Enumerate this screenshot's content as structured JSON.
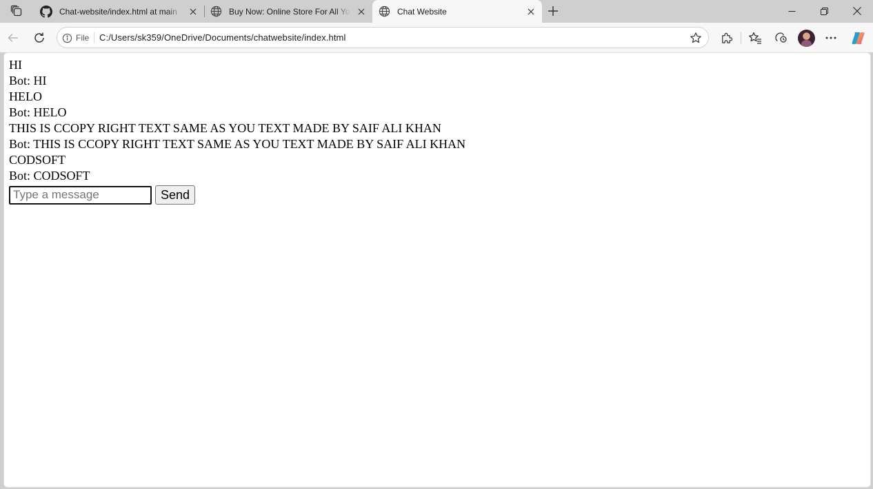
{
  "browser": {
    "tabs": [
      {
        "title": "Chat-website/index.html at main",
        "favicon": "github-icon",
        "active": false
      },
      {
        "title": "Buy Now: Online Store For All You",
        "favicon": "globe-icon",
        "active": false
      },
      {
        "title": "Chat Website",
        "favicon": "globe-icon",
        "active": true
      }
    ],
    "address": {
      "site_label": "File",
      "url": "C:/Users/sk359/OneDrive/Documents/chatwebsite/index.html"
    },
    "toolbar_icons": [
      "back-icon",
      "refresh-icon",
      "info-icon",
      "star-icon",
      "extensions-icon",
      "favorites-icon",
      "browser-essentials-icon",
      "profile-avatar",
      "more-icon",
      "copilot-icon"
    ]
  },
  "chat": {
    "messages": [
      {
        "text": "HI"
      },
      {
        "text": "Bot: HI"
      },
      {
        "text": "HELO"
      },
      {
        "text": "Bot: HELO"
      },
      {
        "text": "THIS IS CCOPY RIGHT TEXT SAME AS YOU TEXT MADE BY SAIF ALI KHAN"
      },
      {
        "text": "Bot: THIS IS CCOPY RIGHT TEXT SAME AS YOU TEXT MADE BY SAIF ALI KHAN"
      },
      {
        "text": "CODSOFT"
      },
      {
        "text": "Bot: CODSOFT"
      }
    ],
    "input": {
      "value": "",
      "placeholder": "Type a message"
    },
    "send_label": "Send"
  },
  "colors": {
    "tabstrip": "#cfcfcf",
    "toolbar": "#f7f7f7",
    "page": "#ffffff"
  }
}
